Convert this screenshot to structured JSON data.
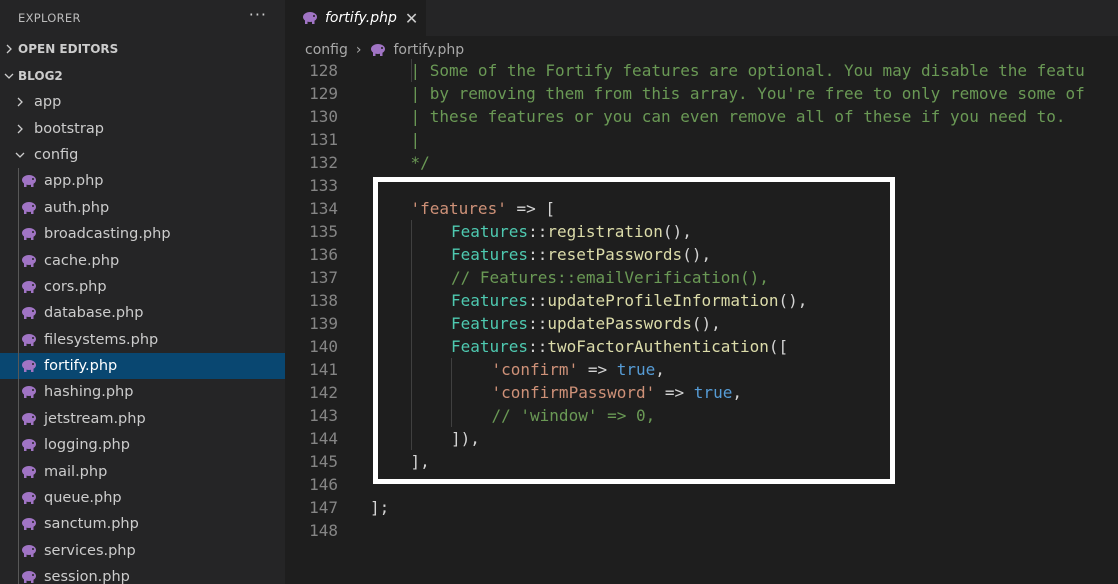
{
  "sidebar": {
    "title": "EXPLORER",
    "more": "···",
    "open_editors": "OPEN EDITORS",
    "project": "BLOG2",
    "folders": [
      {
        "label": "app",
        "chevron": "›"
      },
      {
        "label": "bootstrap",
        "chevron": "›"
      },
      {
        "label": "config",
        "chevron": "⌄"
      }
    ],
    "files": [
      "app.php",
      "auth.php",
      "broadcasting.php",
      "cache.php",
      "cors.php",
      "database.php",
      "filesystems.php",
      "fortify.php",
      "hashing.php",
      "jetstream.php",
      "logging.php",
      "mail.php",
      "queue.php",
      "sanctum.php",
      "services.php",
      "session.php"
    ],
    "active_file": "fortify.php"
  },
  "tab": {
    "label": "fortify.php",
    "close": "✕"
  },
  "breadcrumb": {
    "folder": "config",
    "sep": "›",
    "file": "fortify.php"
  },
  "editor": {
    "lines": [
      {
        "n": "128",
        "guides": [
          1
        ],
        "tokens": [
          {
            "t": "| Some of the Fortify features are optional. You may disable the featu",
            "c": "com"
          }
        ],
        "indent": 1
      },
      {
        "n": "129",
        "guides": [],
        "tokens": [
          {
            "t": "| by removing them from this array. You're free to only remove some of",
            "c": "com"
          }
        ],
        "indent": 1
      },
      {
        "n": "130",
        "guides": [],
        "tokens": [
          {
            "t": "| these features or you can even remove all of these if you need to.",
            "c": "com"
          }
        ],
        "indent": 1
      },
      {
        "n": "131",
        "guides": [],
        "tokens": [
          {
            "t": "|",
            "c": "com"
          }
        ],
        "indent": 1
      },
      {
        "n": "132",
        "guides": [],
        "tokens": [
          {
            "t": "*/",
            "c": "com"
          }
        ],
        "indent": 1
      },
      {
        "n": "133",
        "guides": [],
        "tokens": [],
        "indent": 0
      },
      {
        "n": "134",
        "guides": [],
        "tokens": [
          {
            "t": "'features'",
            "c": "str"
          },
          {
            "t": " => [",
            "c": "p"
          }
        ],
        "indent": 1
      },
      {
        "n": "135",
        "guides": [
          1
        ],
        "tokens": [
          {
            "t": "Features",
            "c": "cls"
          },
          {
            "t": "::",
            "c": "p"
          },
          {
            "t": "registration",
            "c": "fn"
          },
          {
            "t": "(),",
            "c": "p"
          }
        ],
        "indent": 2
      },
      {
        "n": "136",
        "guides": [
          1
        ],
        "tokens": [
          {
            "t": "Features",
            "c": "cls"
          },
          {
            "t": "::",
            "c": "p"
          },
          {
            "t": "resetPasswords",
            "c": "fn"
          },
          {
            "t": "(),",
            "c": "p"
          }
        ],
        "indent": 2
      },
      {
        "n": "137",
        "guides": [
          1
        ],
        "tokens": [
          {
            "t": "// Features::emailVerification(),",
            "c": "com"
          }
        ],
        "indent": 2
      },
      {
        "n": "138",
        "guides": [
          1
        ],
        "tokens": [
          {
            "t": "Features",
            "c": "cls"
          },
          {
            "t": "::",
            "c": "p"
          },
          {
            "t": "updateProfileInformation",
            "c": "fn"
          },
          {
            "t": "(),",
            "c": "p"
          }
        ],
        "indent": 2
      },
      {
        "n": "139",
        "guides": [
          1
        ],
        "tokens": [
          {
            "t": "Features",
            "c": "cls"
          },
          {
            "t": "::",
            "c": "p"
          },
          {
            "t": "updatePasswords",
            "c": "fn"
          },
          {
            "t": "(),",
            "c": "p"
          }
        ],
        "indent": 2
      },
      {
        "n": "140",
        "guides": [
          1
        ],
        "tokens": [
          {
            "t": "Features",
            "c": "cls"
          },
          {
            "t": "::",
            "c": "p"
          },
          {
            "t": "twoFactorAuthentication",
            "c": "fn"
          },
          {
            "t": "([",
            "c": "p"
          }
        ],
        "indent": 2
      },
      {
        "n": "141",
        "guides": [
          1,
          2
        ],
        "tokens": [
          {
            "t": "'confirm'",
            "c": "str"
          },
          {
            "t": " => ",
            "c": "p"
          },
          {
            "t": "true",
            "c": "kw"
          },
          {
            "t": ",",
            "c": "p"
          }
        ],
        "indent": 3
      },
      {
        "n": "142",
        "guides": [
          1,
          2
        ],
        "tokens": [
          {
            "t": "'confirmPassword'",
            "c": "str"
          },
          {
            "t": " => ",
            "c": "p"
          },
          {
            "t": "true",
            "c": "kw"
          },
          {
            "t": ",",
            "c": "p"
          }
        ],
        "indent": 3
      },
      {
        "n": "143",
        "guides": [
          1,
          2
        ],
        "tokens": [
          {
            "t": "// 'window' => 0,",
            "c": "com"
          }
        ],
        "indent": 3
      },
      {
        "n": "144",
        "guides": [
          1
        ],
        "tokens": [
          {
            "t": "]),",
            "c": "p"
          }
        ],
        "indent": 2
      },
      {
        "n": "145",
        "guides": [],
        "tokens": [
          {
            "t": "],",
            "c": "p"
          }
        ],
        "indent": 1
      },
      {
        "n": "146",
        "guides": [],
        "tokens": [],
        "indent": 0
      },
      {
        "n": "147",
        "guides": [],
        "tokens": [
          {
            "t": "];",
            "c": "p"
          }
        ],
        "indent": 0
      },
      {
        "n": "148",
        "guides": [],
        "tokens": [],
        "indent": 0
      }
    ]
  },
  "colors": {
    "accent": "#094771",
    "highlight_border": "#ffffff",
    "php_icon": "#a074c4"
  }
}
